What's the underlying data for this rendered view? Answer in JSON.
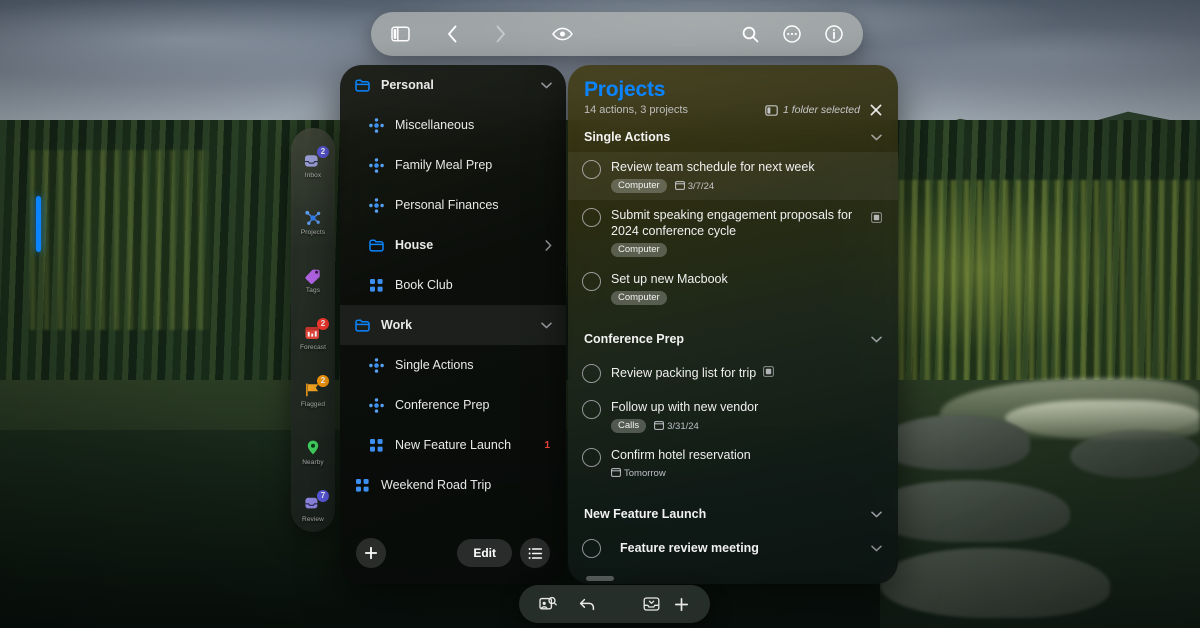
{
  "top_toolbar": {
    "buttons": [
      {
        "name": "sidebar-toggle-icon",
        "label": "Toggle Sidebar"
      },
      {
        "name": "back-icon",
        "label": "Back"
      },
      {
        "name": "forward-icon",
        "label": "Forward"
      },
      {
        "name": "eye-icon",
        "label": "View Options"
      },
      {
        "name": "search-icon",
        "label": "Search"
      },
      {
        "name": "more-icon",
        "label": "More"
      },
      {
        "name": "info-icon",
        "label": "Info"
      }
    ]
  },
  "rail": {
    "items": [
      {
        "label": "Inbox",
        "badge": "2",
        "badge_color": "#5856d6",
        "icon": "inbox-icon",
        "selected": false
      },
      {
        "label": "Projects",
        "badge": "",
        "badge_color": "",
        "icon": "projects-icon",
        "selected": true
      },
      {
        "label": "Tags",
        "badge": "",
        "badge_color": "",
        "icon": "tags-icon",
        "selected": false
      },
      {
        "label": "Forecast",
        "badge": "2",
        "badge_color": "#ff3b30",
        "icon": "forecast-icon",
        "selected": false
      },
      {
        "label": "Flagged",
        "badge": "2",
        "badge_color": "#ff9f0a",
        "icon": "flagged-icon",
        "selected": false
      },
      {
        "label": "Nearby",
        "badge": "",
        "badge_color": "",
        "icon": "nearby-icon",
        "selected": false
      },
      {
        "label": "Review",
        "badge": "7",
        "badge_color": "#5e5ce6",
        "icon": "review-icon",
        "selected": false
      }
    ]
  },
  "folder_panel": {
    "rows": [
      {
        "label": "Personal",
        "icon": "folder-icon",
        "type": "header",
        "indent": 0,
        "chevron": "down",
        "count": "",
        "selected": false
      },
      {
        "label": "Miscellaneous",
        "icon": "project-icon",
        "type": "item",
        "indent": 1,
        "chevron": "",
        "count": "",
        "selected": false
      },
      {
        "label": "Family Meal Prep",
        "icon": "project-icon",
        "type": "item",
        "indent": 1,
        "chevron": "",
        "count": "",
        "selected": false
      },
      {
        "label": "Personal Finances",
        "icon": "project-icon",
        "type": "item",
        "indent": 1,
        "chevron": "",
        "count": "",
        "selected": false
      },
      {
        "label": "House",
        "icon": "folder-icon",
        "type": "header",
        "indent": 1,
        "chevron": "right",
        "count": "",
        "selected": false
      },
      {
        "label": "Book Club",
        "icon": "grid-icon",
        "type": "item",
        "indent": 1,
        "chevron": "",
        "count": "",
        "selected": false
      },
      {
        "label": "Work",
        "icon": "folder-icon",
        "type": "header",
        "indent": 0,
        "chevron": "down",
        "count": "",
        "selected": true
      },
      {
        "label": "Single Actions",
        "icon": "project-icon",
        "type": "item",
        "indent": 1,
        "chevron": "",
        "count": "",
        "selected": false
      },
      {
        "label": "Conference Prep",
        "icon": "project-icon",
        "type": "item",
        "indent": 1,
        "chevron": "",
        "count": "",
        "selected": false
      },
      {
        "label": "New Feature Launch",
        "icon": "grid-icon",
        "type": "item",
        "indent": 1,
        "chevron": "",
        "count": "1",
        "selected": false
      },
      {
        "label": "Weekend Road Trip",
        "icon": "grid-icon",
        "type": "item",
        "indent": 0,
        "chevron": "",
        "count": "",
        "selected": false
      }
    ],
    "footer": {
      "add_label": "+",
      "edit_label": "Edit",
      "list_label": "List Options"
    }
  },
  "content": {
    "title": "Projects",
    "subtitle": "14 actions, 3 projects",
    "folder_selected": "1 folder selected",
    "close_label": "Close",
    "groups": [
      {
        "title": "Single Actions",
        "chevron": "down",
        "tasks": [
          {
            "title": "Review team schedule for next week",
            "tag": "Computer",
            "due": "3/7/24",
            "note": false,
            "highlight": true,
            "chevron": false
          },
          {
            "title": "Submit speaking engagement proposals for 2024 conference cycle",
            "tag": "Computer",
            "due": "",
            "note": true,
            "highlight": false,
            "chevron": false
          },
          {
            "title": "Set up new Macbook",
            "tag": "Computer",
            "due": "",
            "note": false,
            "highlight": false,
            "chevron": false
          }
        ]
      },
      {
        "title": "Conference Prep",
        "chevron": "down",
        "tasks": [
          {
            "title": "Review packing list for trip",
            "tag": "",
            "due": "",
            "note": true,
            "highlight": false,
            "chevron": false
          },
          {
            "title": "Follow up with new vendor",
            "tag": "Calls",
            "due": "3/31/24",
            "note": false,
            "highlight": false,
            "chevron": false
          },
          {
            "title": "Confirm hotel reservation",
            "tag": "",
            "due": "Tomorrow",
            "note": false,
            "highlight": false,
            "chevron": false
          }
        ]
      },
      {
        "title": "New Feature Launch",
        "chevron": "down",
        "tasks": [
          {
            "title": "Feature review meeting",
            "tag": "",
            "due": "",
            "note": false,
            "highlight": false,
            "chevron": true
          }
        ]
      }
    ]
  },
  "bottom_toolbar": {
    "buttons": [
      {
        "name": "quick-capture-icon",
        "label": "Quick Capture"
      },
      {
        "name": "undo-icon",
        "label": "Undo"
      },
      {
        "name": "inbox-tray-icon",
        "label": "Inbox"
      },
      {
        "name": "add-icon",
        "label": "Add"
      }
    ]
  },
  "colors": {
    "accent_blue": "#0a84ff",
    "badge_red": "#ff3b30",
    "badge_orange": "#ff9f0a",
    "badge_purple": "#5e5ce6",
    "count_red": "#ff453a"
  }
}
